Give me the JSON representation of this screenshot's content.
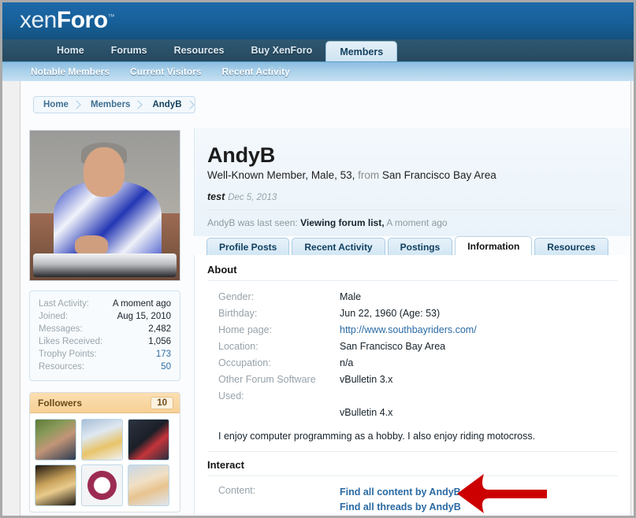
{
  "site": {
    "logo_thin": "xen",
    "logo_bold": "Foro",
    "logo_tm": "™"
  },
  "nav": {
    "primary": [
      {
        "label": "Home",
        "active": false
      },
      {
        "label": "Forums",
        "active": false
      },
      {
        "label": "Resources",
        "active": false
      },
      {
        "label": "Buy XenForo",
        "active": false
      },
      {
        "label": "Members",
        "active": true
      }
    ],
    "secondary": [
      {
        "label": "Notable Members"
      },
      {
        "label": "Current Visitors"
      },
      {
        "label": "Recent Activity"
      }
    ]
  },
  "breadcrumb": [
    {
      "label": "Home"
    },
    {
      "label": "Members"
    },
    {
      "label": "AndyB"
    }
  ],
  "sidebar": {
    "avatar_alt": "AndyB avatar photo",
    "stats": [
      {
        "label": "Last Activity:",
        "value": "A moment ago",
        "is_link": false
      },
      {
        "label": "Joined:",
        "value": "Aug 15, 2010",
        "is_link": false
      },
      {
        "label": "Messages:",
        "value": "2,482",
        "is_link": false
      },
      {
        "label": "Likes Received:",
        "value": "1,056",
        "is_link": false
      },
      {
        "label": "Trophy Points:",
        "value": "173",
        "is_link": true
      },
      {
        "label": "Resources:",
        "value": "50",
        "is_link": true
      }
    ],
    "followers": {
      "title": "Followers",
      "count": "10",
      "avatars": [
        "follower-avatar-man-glasses",
        "follower-avatar-child-hat",
        "follower-avatar-darth-vader",
        "follower-avatar-building-night",
        "follower-avatar-authentic-logo",
        "follower-avatar-anime-girl"
      ]
    }
  },
  "profile": {
    "username": "AndyB",
    "title_rank": "Well-Known Member",
    "gender_short": "Male",
    "age_short": "53",
    "from_word": "from",
    "location_short": "San Francisco Bay Area",
    "status_text": "test",
    "status_date": "Dec 5, 2013",
    "last_seen_prefix": "AndyB was last seen:",
    "last_seen_activity": "Viewing forum list,",
    "last_seen_time": "A moment ago",
    "tabs": [
      {
        "label": "Profile Posts",
        "active": false
      },
      {
        "label": "Recent Activity",
        "active": false
      },
      {
        "label": "Postings",
        "active": false
      },
      {
        "label": "Information",
        "active": true
      },
      {
        "label": "Resources",
        "active": false
      }
    ],
    "about": {
      "section_title": "About",
      "rows": [
        {
          "label": "Gender:",
          "value": "Male",
          "is_link": false
        },
        {
          "label": "Birthday:",
          "value": "Jun 22, 1960 (Age: 53)",
          "is_link": false
        },
        {
          "label": "Home page:",
          "value": "http://www.southbayriders.com/",
          "is_link": true
        },
        {
          "label": "Location:",
          "value": "San Francisco Bay Area",
          "is_link": false
        },
        {
          "label": "Occupation:",
          "value": "n/a",
          "is_link": false
        },
        {
          "label": "Other Forum Software Used:",
          "value": "vBulletin 3.x",
          "is_link": false
        },
        {
          "label": "",
          "value": "vBulletin 4.x",
          "is_link": false
        }
      ],
      "bio": "I enjoy computer programming as a hobby. I also enjoy riding motocross."
    },
    "interact": {
      "section_title": "Interact",
      "content_label": "Content:",
      "links": [
        {
          "label": "Find all content by AndyB"
        },
        {
          "label": "Find all threads by AndyB"
        }
      ]
    }
  },
  "annotation": {
    "arrow_color": "#CC0000",
    "points_to": "Find all threads by AndyB"
  }
}
